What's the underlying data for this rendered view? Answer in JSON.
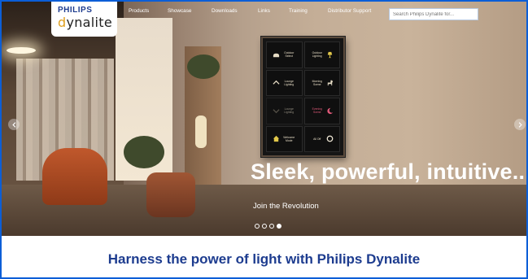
{
  "brand": {
    "company": "PHILIPS",
    "product_prefix": "d",
    "product_rest": "ynalite"
  },
  "nav": {
    "items": [
      {
        "label": "Products"
      },
      {
        "label": "Showcase"
      },
      {
        "label": "Downloads"
      },
      {
        "label": "Links"
      },
      {
        "label": "Training"
      },
      {
        "label": "Distributor Support"
      }
    ],
    "search_placeholder": "Search Philips Dynalite for..."
  },
  "hero": {
    "headline": "Sleek, powerful, intuitive...",
    "cta": "Join the Revolution",
    "slides": 4,
    "active_slide": 4,
    "panel_buttons": [
      {
        "label": "Outdoor Select",
        "icon": "sofa-icon"
      },
      {
        "label": "Outdoor Lighting",
        "icon": "lamp-icon"
      },
      {
        "label": "Lounge Lighting",
        "icon": "chevron-up-icon"
      },
      {
        "label": "Morning Scene",
        "icon": "dog-icon"
      },
      {
        "label": "Lounge Lighting",
        "icon": "chevron-down-icon"
      },
      {
        "label": "Evening Scene",
        "icon": "moon-icon"
      },
      {
        "label": "Welcome Mode",
        "icon": "house-icon"
      },
      {
        "label": "All Off",
        "icon": "circle-icon"
      }
    ]
  },
  "tagline": "Harness the power of light with Philips Dynalite",
  "colors": {
    "brand_blue": "#1d3c8f",
    "dynalite_accent": "#e0a020",
    "frame_blue": "#0b5ed7"
  }
}
